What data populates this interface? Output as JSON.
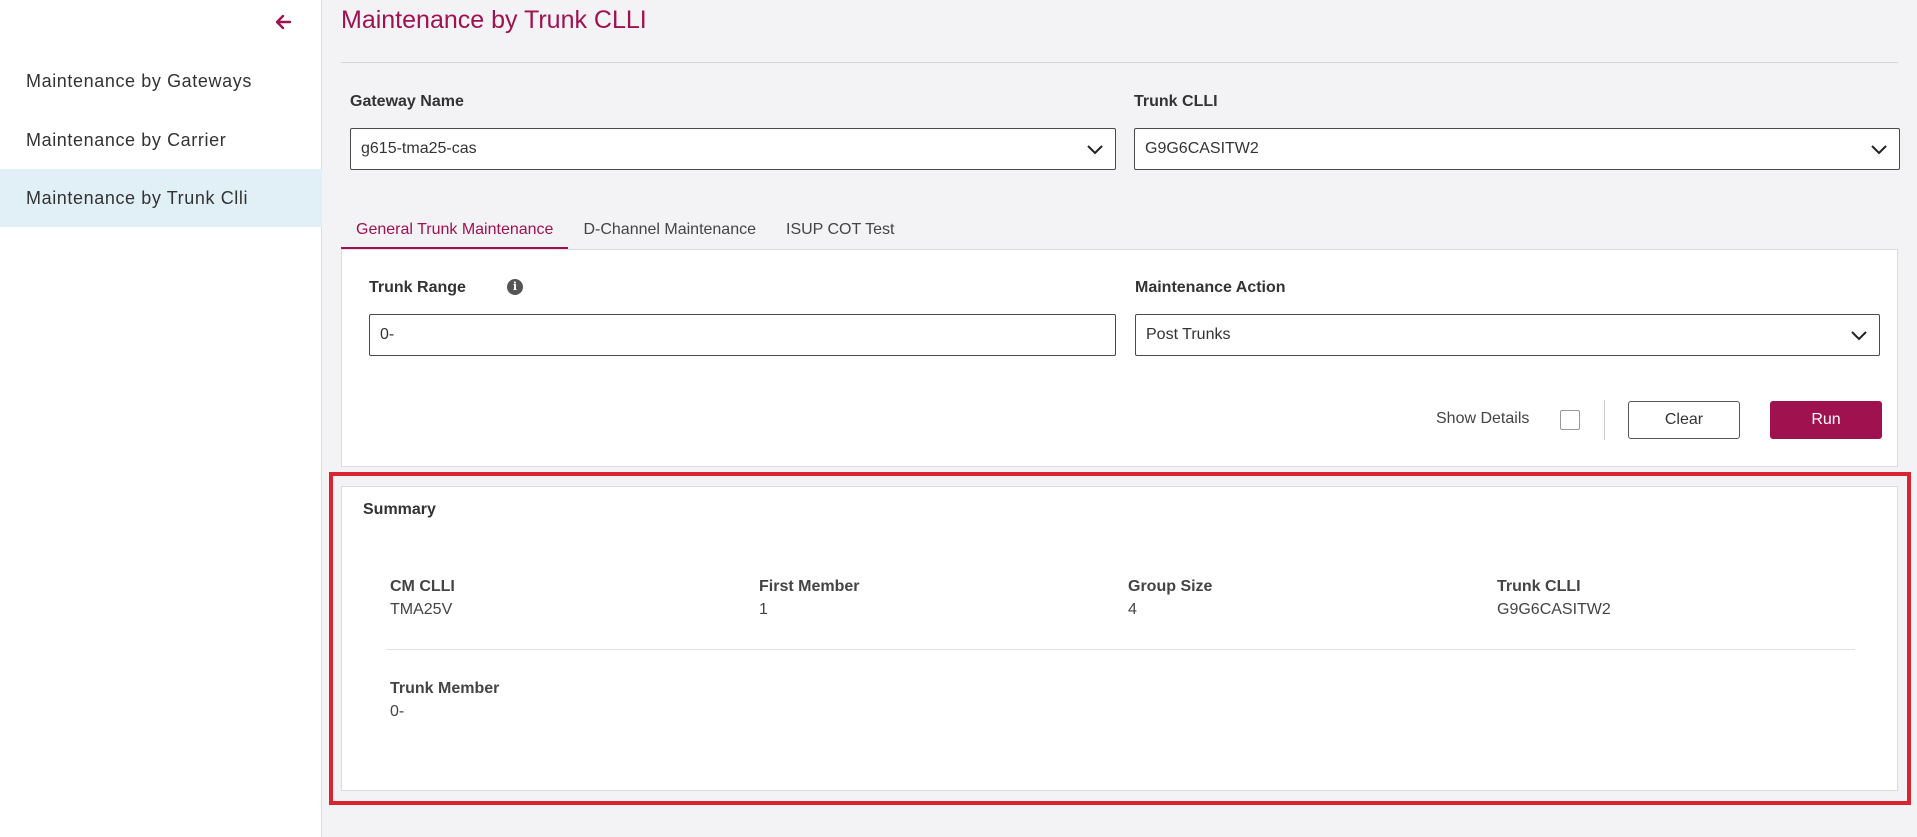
{
  "sidebar": {
    "items": [
      {
        "label": "Maintenance by Gateways"
      },
      {
        "label": "Maintenance by Carrier"
      },
      {
        "label": "Maintenance by Trunk Clli"
      }
    ],
    "active_index": 2,
    "back_icon": "arrow-left-icon"
  },
  "header": {
    "title": "Maintenance by Trunk CLLI"
  },
  "filters": {
    "gateway": {
      "label": "Gateway Name",
      "value": "g615-tma25-cas"
    },
    "trunk_clli": {
      "label": "Trunk CLLI",
      "value": "G9G6CASITW2"
    }
  },
  "tabs": [
    {
      "label": "General Trunk Maintenance",
      "active": true
    },
    {
      "label": "D-Channel Maintenance",
      "active": false
    },
    {
      "label": "ISUP COT Test",
      "active": false
    }
  ],
  "form": {
    "trunk_range": {
      "label": "Trunk Range",
      "value": "0-",
      "info_icon": "info-icon"
    },
    "maintenance_action": {
      "label": "Maintenance Action",
      "value": "Post Trunks"
    },
    "show_details_label": "Show Details",
    "show_details_checked": false,
    "clear_label": "Clear",
    "run_label": "Run"
  },
  "summary": {
    "title": "Summary",
    "fields": [
      {
        "label": "CM CLLI",
        "value": "TMA25V"
      },
      {
        "label": "First Member",
        "value": "1"
      },
      {
        "label": "Group Size",
        "value": "4"
      },
      {
        "label": "Trunk CLLI",
        "value": "G9G6CASITW2"
      },
      {
        "label": "Trunk Member",
        "value": "0-"
      }
    ]
  },
  "colors": {
    "accent": "#a0114f",
    "active_nav_bg": "#e1f0f7",
    "highlight_border": "#d9252f"
  }
}
